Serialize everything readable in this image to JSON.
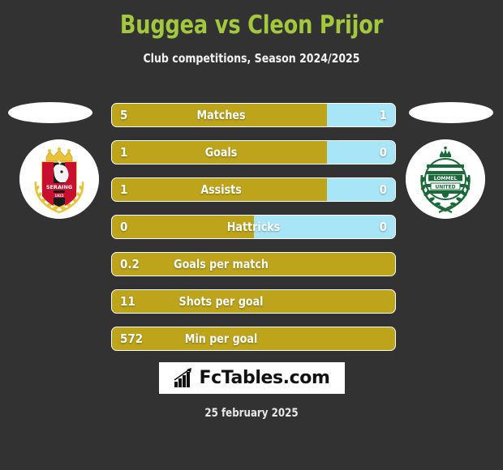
{
  "header": {
    "title": "Buggea vs Cleon Prijor",
    "subtitle": "Club competitions, Season 2024/2025",
    "title_color": "#a3c83e"
  },
  "teams": {
    "home": {
      "name": "Seraing",
      "crest_name": "seraing-crest",
      "colors": [
        "#c8102e",
        "#1a1a1a",
        "#e8c33a"
      ]
    },
    "away": {
      "name": "Lommel United",
      "crest_name": "lommel-united-crest",
      "colors": [
        "#1b6b3a",
        "#ffffff"
      ]
    }
  },
  "colors": {
    "background": "#323232",
    "home_bar": "#bda41b",
    "away_bar": "#a7e5f7",
    "text": "#ffffff"
  },
  "stats": [
    {
      "label": "Matches",
      "home": "5",
      "away": "1",
      "home_pct": 76,
      "away_pct": 24,
      "has_away": true
    },
    {
      "label": "Goals",
      "home": "1",
      "away": "0",
      "home_pct": 76,
      "away_pct": 24,
      "has_away": true
    },
    {
      "label": "Assists",
      "home": "1",
      "away": "0",
      "home_pct": 76,
      "away_pct": 24,
      "has_away": true
    },
    {
      "label": "Hattricks",
      "home": "0",
      "away": "0",
      "home_pct": 50,
      "away_pct": 50,
      "has_away": true
    },
    {
      "label": "Goals per match",
      "home": "0.2",
      "away": "",
      "home_pct": 100,
      "away_pct": 0,
      "has_away": false
    },
    {
      "label": "Shots per goal",
      "home": "11",
      "away": "",
      "home_pct": 100,
      "away_pct": 0,
      "has_away": false
    },
    {
      "label": "Min per goal",
      "home": "572",
      "away": "",
      "home_pct": 100,
      "away_pct": 0,
      "has_away": false
    }
  ],
  "footer": {
    "brand": "FcTables.com",
    "brand_icon": "bar-chart-icon",
    "date": "25 february 2025"
  }
}
